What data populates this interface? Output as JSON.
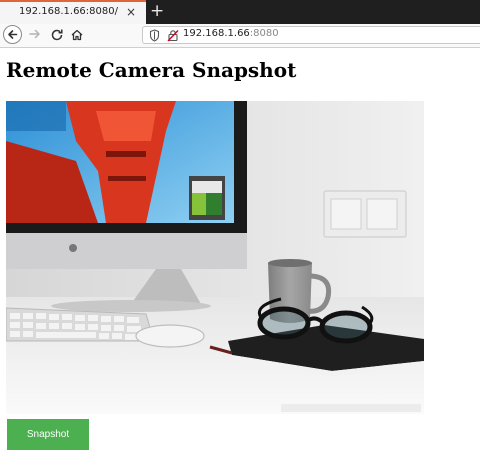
{
  "browser": {
    "tab_title": "192.168.1.66:8080/",
    "tab_close": "×",
    "new_tab": "+",
    "url_host": "192.168.1.66",
    "url_port": ":8080"
  },
  "page": {
    "heading": "Remote Camera Snapshot",
    "snapshot_button": "Snapshot",
    "button_color": "#4caf50"
  },
  "snapshot_image": {
    "subject": "desk with monitor, keyboard, mouse, mug, notebook and glasses"
  }
}
